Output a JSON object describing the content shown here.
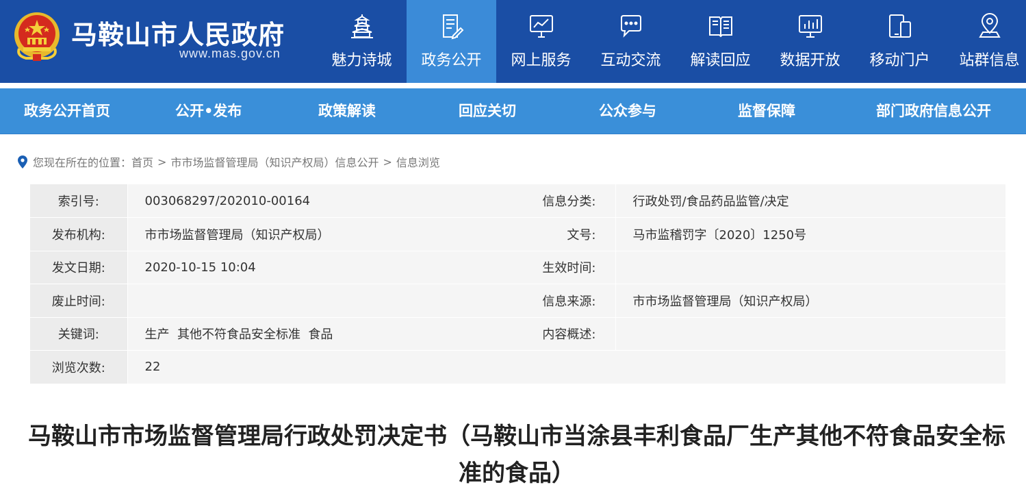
{
  "header": {
    "site_name": "马鞍山市人民政府",
    "site_url": "www.mas.gov.cn",
    "brand_color": "#1a4ea5",
    "active_color": "#3b8bd8",
    "nav": [
      {
        "label": "魅力诗城",
        "icon": "pagoda-icon"
      },
      {
        "label": "政务公开",
        "icon": "document-icon",
        "active": true
      },
      {
        "label": "网上服务",
        "icon": "monitor-icon"
      },
      {
        "label": "互动交流",
        "icon": "chat-bubble-icon"
      },
      {
        "label": "解读回应",
        "icon": "open-book-icon"
      },
      {
        "label": "数据开放",
        "icon": "bar-screen-icon"
      },
      {
        "label": "移动门户",
        "icon": "mobile-tablet-icon"
      },
      {
        "label": "站群信息",
        "icon": "location-pin-icon"
      }
    ]
  },
  "subnav": {
    "color": "#3a8fd9",
    "items": [
      "政务公开首页",
      "公开•发布",
      "政策解读",
      "回应关切",
      "公众参与",
      "监督保障",
      "部门政府信息公开"
    ]
  },
  "breadcrumb": {
    "prefix": "您现在所在的位置：",
    "items": [
      "首页",
      "市市场监督管理局（知识产权局）信息公开",
      "信息浏览"
    ],
    "separator": ">"
  },
  "info": {
    "rows": [
      {
        "k1": "索引号:",
        "v1": "003068297/202010-00164",
        "k2": "信息分类:",
        "v2": "行政处罚/食品药品监管/决定"
      },
      {
        "k1": "发布机构:",
        "v1": "市市场监督管理局（知识产权局）",
        "k2": "文号:",
        "v2": "马市监稽罚字〔2020〕1250号"
      },
      {
        "k1": "发文日期:",
        "v1": "2020-10-15 10:04",
        "k2": "生效时间:",
        "v2": ""
      },
      {
        "k1": "废止时间:",
        "v1": "",
        "k2": "信息来源:",
        "v2": "市市场监督管理局（知识产权局）"
      },
      {
        "k1": "关键词:",
        "v1": "生产  其他不符食品安全标准  食品",
        "k2": "内容概述:",
        "v2": ""
      }
    ],
    "views_label": "浏览次数:",
    "views_value": "22"
  },
  "article": {
    "title": "马鞍山市市场监督管理局行政处罚决定书（马鞍山市当涂县丰利食品厂生产其他不符食品安全标准的食品）"
  }
}
